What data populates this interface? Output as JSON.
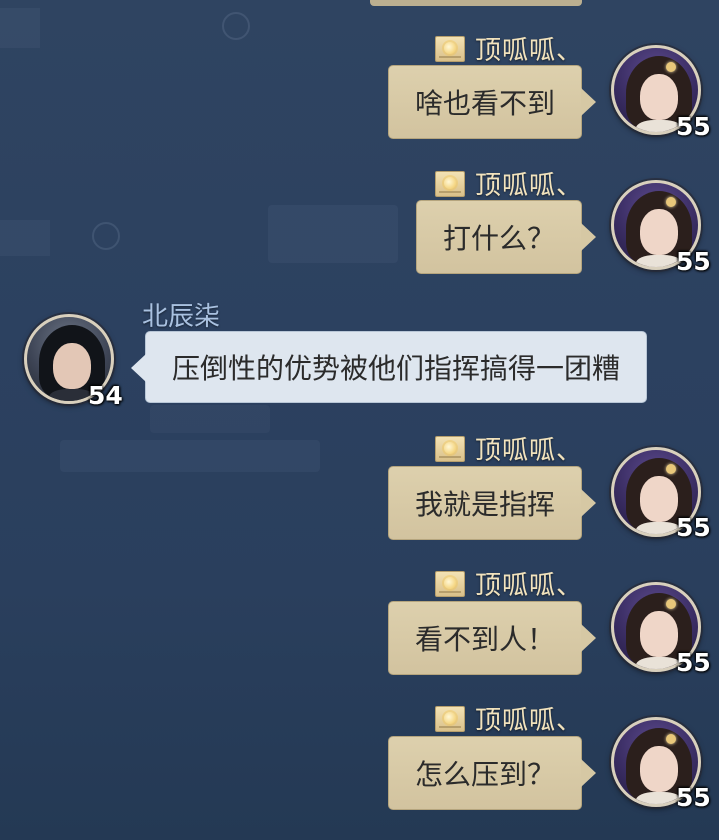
{
  "me": {
    "name": "顶呱呱、",
    "level": "55",
    "badge_icon": "sun-badge-icon"
  },
  "other": {
    "name": "北辰柒",
    "level": "54"
  },
  "messages": [
    {
      "from": "me",
      "text": "啥也看不到"
    },
    {
      "from": "me",
      "text": "打什么？"
    },
    {
      "from": "other",
      "text": "压倒性的优势被他们指挥搞得一团糟"
    },
    {
      "from": "me",
      "text": "我就是指挥"
    },
    {
      "from": "me",
      "text": "看不到人！"
    },
    {
      "from": "me",
      "text": "怎么压到？"
    }
  ],
  "background": {
    "color": "#2d4260",
    "bubble_mine_color": "#d6c8a4",
    "bubble_other_color": "#dee6ef",
    "name_mine_color": "#f2e3bd",
    "name_other_color": "#a9c1e0"
  }
}
